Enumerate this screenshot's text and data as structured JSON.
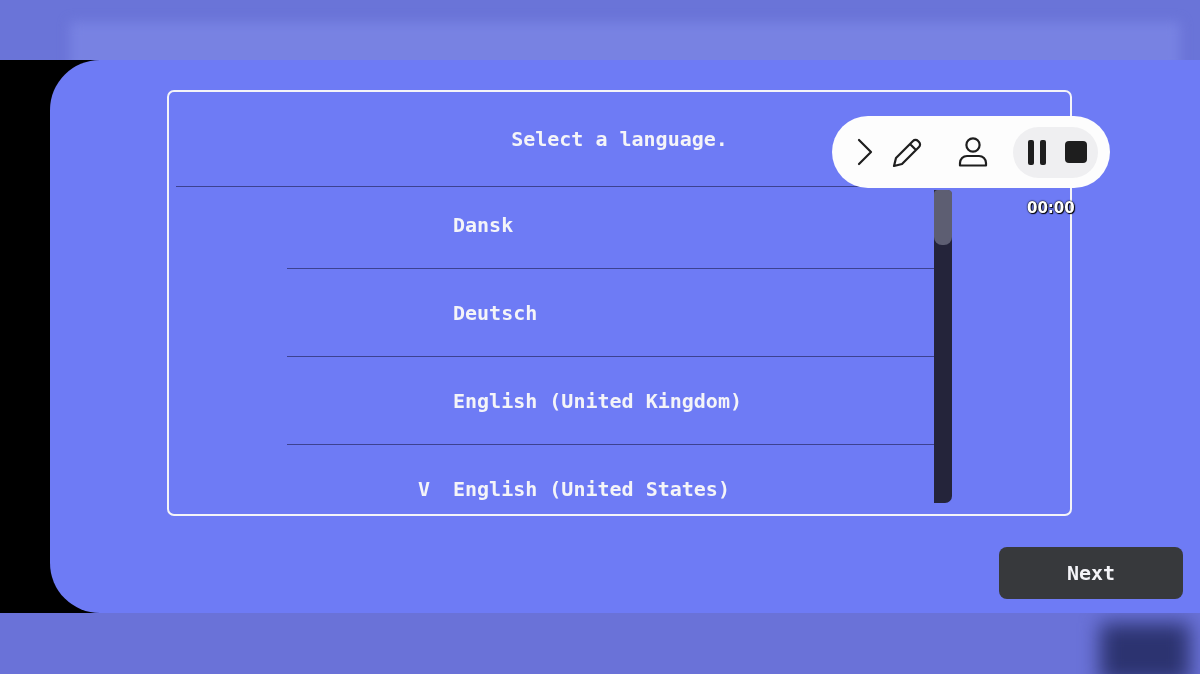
{
  "dialog": {
    "title": "Select a language.",
    "selection_mark": "V",
    "languages": [
      {
        "label": "Dansk",
        "selected": false
      },
      {
        "label": "Deutsch",
        "selected": false
      },
      {
        "label": "English (United Kingdom)",
        "selected": false
      },
      {
        "label": "English (United States)",
        "selected": true
      }
    ]
  },
  "recorder": {
    "timer": "00:00"
  },
  "next_button": "Next"
}
